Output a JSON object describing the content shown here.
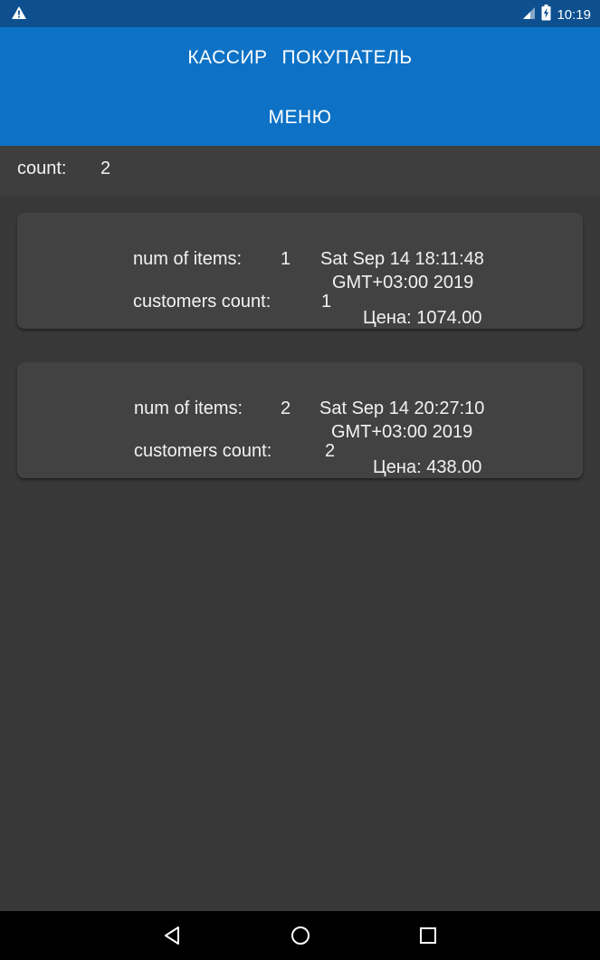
{
  "status_bar": {
    "time": "10:19",
    "warning_icon": "warning-triangle-icon",
    "signal_icon": "signal-icon",
    "battery_icon": "battery-charging-icon"
  },
  "app_bar": {
    "tab_cashier": "КАССИР",
    "tab_customer": "ПОКУПАТЕЛЬ",
    "menu_label": "МЕНЮ",
    "color": "#0d72c6"
  },
  "summary": {
    "count_label": "count:",
    "count_value": "2"
  },
  "orders": [
    {
      "items_label": "num of items:",
      "items_value": "1",
      "datetime_line1": "Sat Sep 14 18:11:48",
      "datetime_line2": "GMT+03:00 2019",
      "customers_label": "customers count:",
      "customers_value": "1",
      "price": "Цена: 1074.00"
    },
    {
      "items_label": "num of items:",
      "items_value": "2",
      "datetime_line1": "Sat Sep 14 20:27:10",
      "datetime_line2": "GMT+03:00 2019",
      "customers_label": "customers count:",
      "customers_value": "2",
      "price": "Цена: 438.00"
    }
  ],
  "nav_bar": {
    "back_icon": "back-triangle-icon",
    "home_icon": "home-circle-icon",
    "recents_icon": "recents-square-icon"
  }
}
